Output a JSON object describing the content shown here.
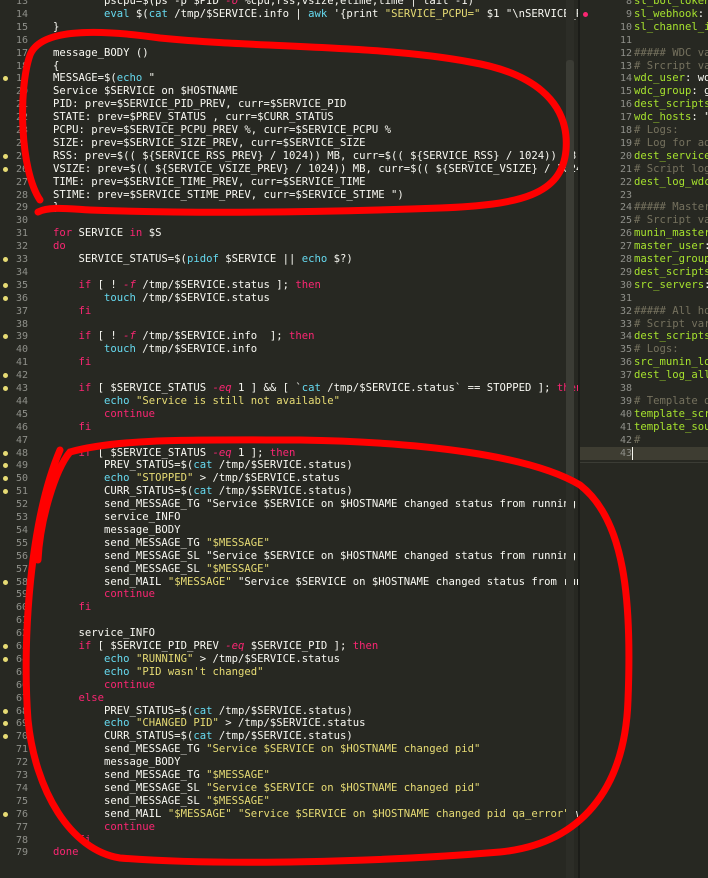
{
  "left_editor": {
    "lines": [
      {
        "n": "13",
        "mark": "",
        "text": "        pscpu=$(ps -p $PID -o %cpu,rss,vsize,etime,time | tail -1)"
      },
      {
        "n": "14",
        "mark": "",
        "text": "        eval $(cat /tmp/$SERVICE.info | awk '{print \"SERVICE_PCPU=\" $1 \"\\nSERVICE_RSS"
      },
      {
        "n": "15",
        "mark": "",
        "text": "}"
      },
      {
        "n": "16",
        "mark": "",
        "text": ""
      },
      {
        "n": "17",
        "mark": "",
        "text": "message_BODY ()"
      },
      {
        "n": "18",
        "mark": "",
        "text": "{"
      },
      {
        "n": "19",
        "mark": "yellow",
        "text": "MESSAGE=$(echo \""
      },
      {
        "n": "20",
        "mark": "",
        "text": "Service $SERVICE on $HOSTNAME"
      },
      {
        "n": "21",
        "mark": "",
        "text": "PID: prev=$SERVICE_PID_PREV, curr=$SERVICE_PID"
      },
      {
        "n": "22",
        "mark": "",
        "text": "STATE: prev=$PREV_STATUS , curr=$CURR_STATUS"
      },
      {
        "n": "23",
        "mark": "",
        "text": "PCPU: prev=$SERVICE_PCPU_PREV %, curr=$SERVICE_PCPU %"
      },
      {
        "n": "24",
        "mark": "",
        "text": "SIZE: prev=$SERVICE_SIZE_PREV, curr=$SERVICE_SIZE"
      },
      {
        "n": "25",
        "mark": "yellow",
        "text": "RSS: prev=$(( ${SERVICE_RSS_PREV} / 1024)) MB, curr=$(( ${SERVICE_RSS} / 1024)) MB"
      },
      {
        "n": "26",
        "mark": "yellow",
        "text": "VSIZE: prev=$(( ${SERVICE_VSIZE_PREV} / 1024)) MB, curr=$(( ${SERVICE_VSIZE} / 1024)) MB"
      },
      {
        "n": "27",
        "mark": "",
        "text": "TIME: prev=$SERVICE_TIME_PREV, curr=$SERVICE_TIME"
      },
      {
        "n": "28",
        "mark": "",
        "text": "STIME: prev=$SERVICE_STIME_PREV, curr=$SERVICE_STIME \")"
      },
      {
        "n": "29",
        "mark": "",
        "text": "}"
      },
      {
        "n": "30",
        "mark": "",
        "text": ""
      },
      {
        "n": "31",
        "mark": "",
        "text": "for SERVICE in $S"
      },
      {
        "n": "32",
        "mark": "",
        "text": "do"
      },
      {
        "n": "33",
        "mark": "yellow",
        "text": "    SERVICE_STATUS=$(pidof $SERVICE || echo $?)"
      },
      {
        "n": "34",
        "mark": "",
        "text": ""
      },
      {
        "n": "35",
        "mark": "yellow",
        "text": "    if [ ! -f /tmp/$SERVICE.status ]; then"
      },
      {
        "n": "36",
        "mark": "yellow",
        "text": "        touch /tmp/$SERVICE.status"
      },
      {
        "n": "37",
        "mark": "",
        "text": "    fi"
      },
      {
        "n": "38",
        "mark": "",
        "text": ""
      },
      {
        "n": "39",
        "mark": "yellow",
        "text": "    if [ ! -f /tmp/$SERVICE.info  ]; then"
      },
      {
        "n": "40",
        "mark": "",
        "text": "        touch /tmp/$SERVICE.info"
      },
      {
        "n": "41",
        "mark": "",
        "text": "    fi"
      },
      {
        "n": "42",
        "mark": "yellow",
        "text": ""
      },
      {
        "n": "43",
        "mark": "yellow",
        "text": "    if [ $SERVICE_STATUS -eq 1 ] && [ `cat /tmp/$SERVICE.status` == STOPPED ]; then"
      },
      {
        "n": "44",
        "mark": "",
        "text": "        echo \"Service is still not available\""
      },
      {
        "n": "45",
        "mark": "",
        "text": "        continue"
      },
      {
        "n": "46",
        "mark": "",
        "text": "    fi"
      },
      {
        "n": "47",
        "mark": "",
        "text": ""
      },
      {
        "n": "48",
        "mark": "yellow",
        "text": "    if [ $SERVICE_STATUS -eq 1 ]; then"
      },
      {
        "n": "49",
        "mark": "yellow",
        "text": "        PREV_STATUS=$(cat /tmp/$SERVICE.status)"
      },
      {
        "n": "50",
        "mark": "yellow",
        "text": "        echo \"STOPPED\" > /tmp/$SERVICE.status"
      },
      {
        "n": "51",
        "mark": "yellow",
        "text": "        CURR_STATUS=$(cat /tmp/$SERVICE.status)"
      },
      {
        "n": "52",
        "mark": "",
        "text": "        send_MESSAGE_TG \"Service $SERVICE on $HOSTNAME changed status from running to"
      },
      {
        "n": "53",
        "mark": "",
        "text": "        service_INFO"
      },
      {
        "n": "54",
        "mark": "",
        "text": "        message_BODY"
      },
      {
        "n": "55",
        "mark": "",
        "text": "        send_MESSAGE_TG \"$MESSAGE\""
      },
      {
        "n": "56",
        "mark": "",
        "text": "        send_MESSAGE_SL \"Service $SERVICE on $HOSTNAME changed status from running to"
      },
      {
        "n": "57",
        "mark": "",
        "text": "        send_MESSAGE_SL \"$MESSAGE\""
      },
      {
        "n": "58",
        "mark": "yellow",
        "text": "        send_MAIL \"$MESSAGE\" \"Service $SERVICE on $HOSTNAME changed status from runni"
      },
      {
        "n": "59",
        "mark": "",
        "text": "        continue"
      },
      {
        "n": "60",
        "mark": "",
        "text": "    fi"
      },
      {
        "n": "61",
        "mark": "",
        "text": ""
      },
      {
        "n": "62",
        "mark": "",
        "text": "    service_INFO"
      },
      {
        "n": "63",
        "mark": "yellow",
        "text": "    if [ $SERVICE_PID_PREV -eq $SERVICE_PID ]; then"
      },
      {
        "n": "64",
        "mark": "yellow",
        "text": "        echo \"RUNNING\" > /tmp/$SERVICE.status"
      },
      {
        "n": "65",
        "mark": "",
        "text": "        echo \"PID wasn't changed\""
      },
      {
        "n": "66",
        "mark": "",
        "text": "        continue"
      },
      {
        "n": "67",
        "mark": "",
        "text": "    else"
      },
      {
        "n": "68",
        "mark": "yellow",
        "text": "        PREV_STATUS=$(cat /tmp/$SERVICE.status)"
      },
      {
        "n": "69",
        "mark": "yellow",
        "text": "        echo \"CHANGED PID\" > /tmp/$SERVICE.status"
      },
      {
        "n": "70",
        "mark": "yellow",
        "text": "        CURR_STATUS=$(cat /tmp/$SERVICE.status)"
      },
      {
        "n": "71",
        "mark": "",
        "text": "        send_MESSAGE_TG \"Service $SERVICE on $HOSTNAME changed pid\""
      },
      {
        "n": "72",
        "mark": "",
        "text": "        message_BODY"
      },
      {
        "n": "73",
        "mark": "",
        "text": "        send_MESSAGE_TG \"$MESSAGE\""
      },
      {
        "n": "74",
        "mark": "",
        "text": "        send_MESSAGE_SL \"Service $SERVICE on $HOSTNAME changed pid\""
      },
      {
        "n": "75",
        "mark": "",
        "text": "        send_MESSAGE_SL \"$MESSAGE\""
      },
      {
        "n": "76",
        "mark": "yellow",
        "text": "        send_MAIL \"$MESSAGE\" \"Service $SERVICE on $HOSTNAME changed pid qa_error\" wdc"
      },
      {
        "n": "77",
        "mark": "",
        "text": "        continue"
      },
      {
        "n": "78",
        "mark": "",
        "text": "    fi"
      },
      {
        "n": "79",
        "mark": "",
        "text": "done"
      }
    ]
  },
  "right_editor": {
    "lines": [
      {
        "n": "8",
        "mark": "",
        "text": "sl_bot_token"
      },
      {
        "n": "9",
        "mark": "red",
        "text": "sl_webhook: h"
      },
      {
        "n": "10",
        "mark": "",
        "text": "sl_channel_i"
      },
      {
        "n": "11",
        "mark": "",
        "text": ""
      },
      {
        "n": "12",
        "mark": "",
        "text": "##### WDC var"
      },
      {
        "n": "13",
        "mark": "",
        "text": "# Srcript va"
      },
      {
        "n": "14",
        "mark": "",
        "text": "wdc_user: wd"
      },
      {
        "n": "15",
        "mark": "",
        "text": "wdc_group: gu"
      },
      {
        "n": "16",
        "mark": "",
        "text": "dest_scripts"
      },
      {
        "n": "17",
        "mark": "",
        "text": "wdc_hosts: \"-"
      },
      {
        "n": "18",
        "mark": "",
        "text": "# Logs:"
      },
      {
        "n": "19",
        "mark": "",
        "text": "# Log for ad"
      },
      {
        "n": "20",
        "mark": "",
        "text": "dest_service"
      },
      {
        "n": "21",
        "mark": "",
        "text": "# Script log"
      },
      {
        "n": "22",
        "mark": "",
        "text": "dest_log_wdc"
      },
      {
        "n": "23",
        "mark": "",
        "text": ""
      },
      {
        "n": "24",
        "mark": "",
        "text": "##### Master"
      },
      {
        "n": "25",
        "mark": "",
        "text": "# Srcript va"
      },
      {
        "n": "26",
        "mark": "",
        "text": "munin_master"
      },
      {
        "n": "27",
        "mark": "",
        "text": "master_user:"
      },
      {
        "n": "28",
        "mark": "",
        "text": "master_group"
      },
      {
        "n": "29",
        "mark": "",
        "text": "dest_scripts"
      },
      {
        "n": "30",
        "mark": "",
        "text": "src_servers:"
      },
      {
        "n": "31",
        "mark": "",
        "text": ""
      },
      {
        "n": "32",
        "mark": "",
        "text": "##### All ho"
      },
      {
        "n": "33",
        "mark": "",
        "text": "# Script var"
      },
      {
        "n": "34",
        "mark": "",
        "text": "dest_scripts"
      },
      {
        "n": "35",
        "mark": "",
        "text": "# Logs:"
      },
      {
        "n": "36",
        "mark": "",
        "text": "src_munin_lo"
      },
      {
        "n": "37",
        "mark": "",
        "text": "dest_log_all"
      },
      {
        "n": "38",
        "mark": "",
        "text": ""
      },
      {
        "n": "39",
        "mark": "",
        "text": "# Template d"
      },
      {
        "n": "40",
        "mark": "",
        "text": "template_scr"
      },
      {
        "n": "41",
        "mark": "",
        "text": "template_sou"
      },
      {
        "n": "42",
        "mark": "",
        "text": "#"
      },
      {
        "n": "43",
        "mark": "",
        "text": ""
      }
    ]
  },
  "colors": {
    "keyword": "#f92672",
    "string": "#e6db74",
    "variable": "#f8f8f2",
    "function": "#66d9ef",
    "comment": "#75715e",
    "annotation": "#ff0000"
  }
}
